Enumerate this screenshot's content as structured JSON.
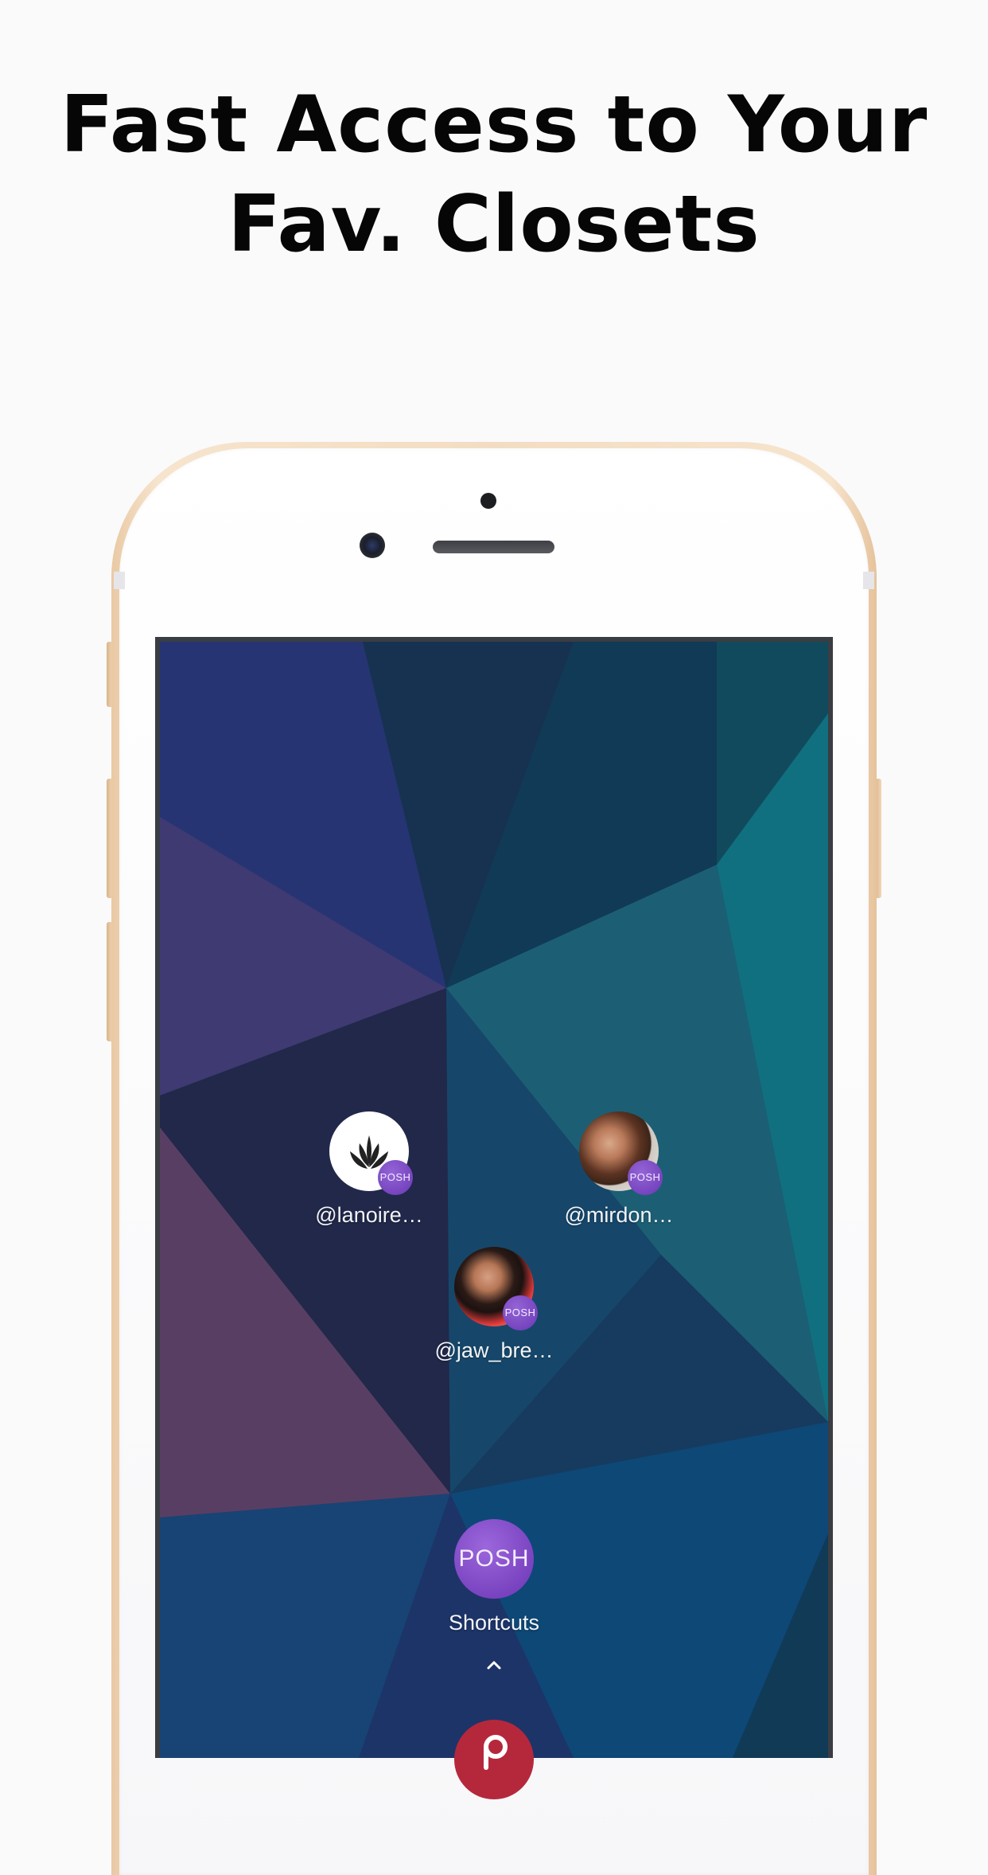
{
  "headline": {
    "line1": "Fast Access to Your",
    "line2": "Fav. Closets"
  },
  "shortcuts": [
    {
      "label": "@lanoire…",
      "badge": "POSH",
      "avatar": "lotus-logo"
    },
    {
      "label": "@mirdon…",
      "badge": "POSH",
      "avatar": "user-photo"
    },
    {
      "label": "@jaw_bre…",
      "badge": "POSH",
      "avatar": "user-photo"
    }
  ],
  "app": {
    "icon_text": "POSH",
    "label": "Shortcuts"
  },
  "colors": {
    "posh_purple": "#7a46c4",
    "bottom_app_red": "#b5283c",
    "phone_gold": "#f3ddc2"
  }
}
